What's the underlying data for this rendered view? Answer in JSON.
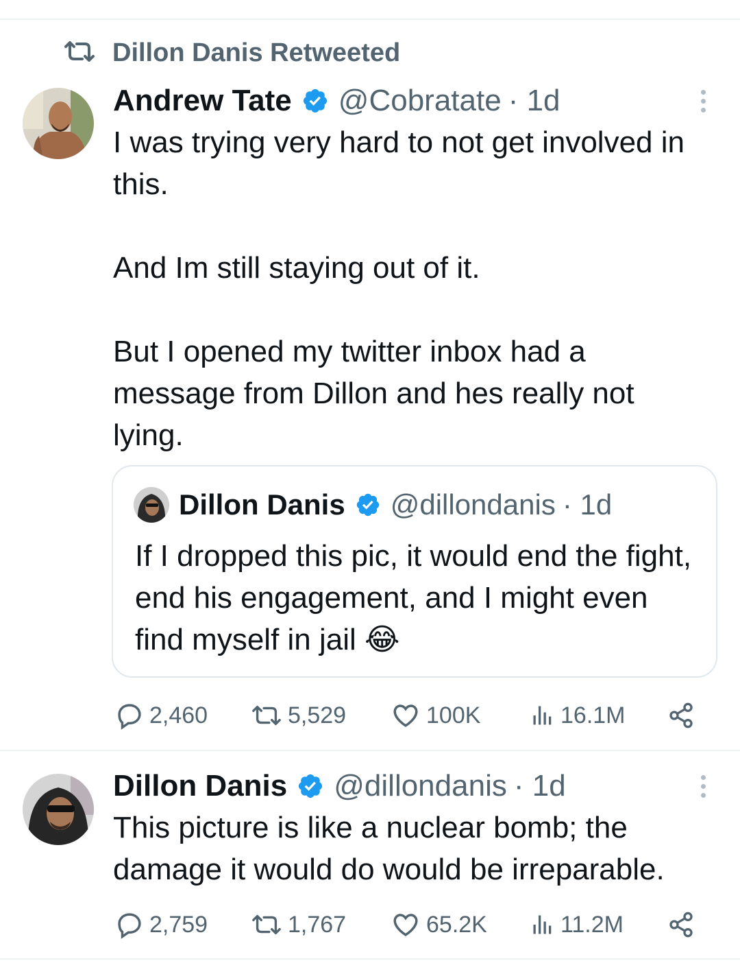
{
  "retweet_banner": {
    "icon": "retweet-icon",
    "label": "Dillon Danis Retweeted"
  },
  "tweet1": {
    "author_name": "Andrew Tate",
    "verified_icon": "verified-badge-icon",
    "handle": "@Cobratate",
    "time": "· 1d",
    "paragraphs": [
      "I was trying very hard to not get involved in this.",
      "And Im still staying out of it.",
      "But I opened my twitter inbox had a message from Dillon and hes really not lying."
    ],
    "quote": {
      "author_name": "Dillon Danis",
      "handle": "@dillondanis",
      "time": "· 1d",
      "text": "If I dropped this pic, it would end the fight, end his engagement, and I might even find myself in jail",
      "emoji": "😂"
    },
    "stats": {
      "replies": "2,460",
      "retweets": "5,529",
      "likes": "100K",
      "views": "16.1M"
    }
  },
  "tweet2": {
    "author_name": "Dillon Danis",
    "handle": "@dillondanis",
    "time": "· 1d",
    "text": "This picture is like a nuclear bomb; the damage it would do would be irreparable.",
    "stats": {
      "replies": "2,759",
      "retweets": "1,767",
      "likes": "65.2K",
      "views": "11.2M"
    }
  },
  "colors": {
    "text": "#0f1419",
    "secondary": "#536471",
    "verified": "#1d9bf0",
    "border": "#e1e8ed"
  }
}
